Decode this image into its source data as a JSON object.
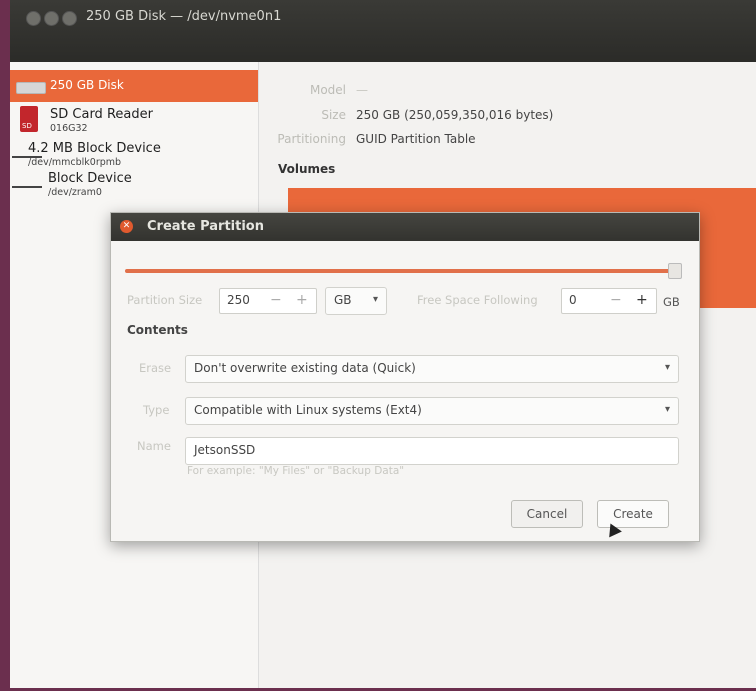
{
  "window": {
    "title": "250 GB Disk — /dev/nvme0n1"
  },
  "sidebar": {
    "items": [
      {
        "name": "250 GB Disk",
        "sub": ""
      },
      {
        "name": "SD Card Reader",
        "sub": "016G32"
      },
      {
        "name": "4.2 MB Block Device",
        "sub": "/dev/mmcblk0rpmb"
      },
      {
        "name": "Block Device",
        "sub": "/dev/zram0"
      }
    ]
  },
  "details": {
    "model_label": "Model",
    "model_value": "—",
    "size_label": "Size",
    "size_value": "250 GB (250,059,350,016 bytes)",
    "partitioning_label": "Partitioning",
    "partitioning_value": "GUID Partition Table",
    "volumes_label": "Volumes"
  },
  "dialog": {
    "title": "Create Partition",
    "partition_size_label": "Partition Size",
    "partition_size_value": "250",
    "size_unit": "GB",
    "free_space_label": "Free Space Following",
    "free_space_value": "0",
    "free_space_unit": "GB",
    "contents_label": "Contents",
    "erase_label": "Erase",
    "erase_value": "Don't overwrite existing data (Quick)",
    "type_label": "Type",
    "type_value": "Compatible with Linux systems (Ext4)",
    "name_label": "Name",
    "name_value": "JetsonSSD",
    "hint": "For example: \"My Files\" or \"Backup Data\"",
    "cancel_label": "Cancel",
    "create_label": "Create"
  }
}
